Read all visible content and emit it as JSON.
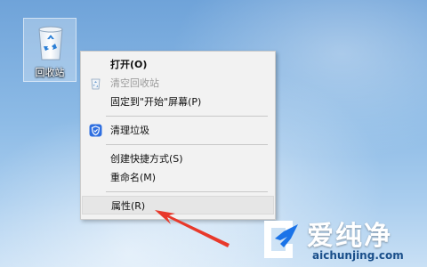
{
  "desktop": {
    "recycle_bin": {
      "label": "回收站",
      "icon": "recycle-bin-icon"
    }
  },
  "context_menu": {
    "items": [
      {
        "label": "打开(O)",
        "bold": true
      },
      {
        "label": "清空回收站",
        "disabled": true,
        "icon": "recycle-bin-empty-icon"
      },
      {
        "label": "固定到\"开始\"屏幕(P)"
      },
      {
        "label": "清理垃圾",
        "icon": "shield-clean-icon"
      },
      {
        "label": "创建快捷方式(S)"
      },
      {
        "label": "重命名(M)"
      },
      {
        "label": "属性(R)",
        "highlighted": true
      }
    ]
  },
  "annotation": {
    "arrow_color": "#e8392b"
  },
  "watermark": {
    "name": "爱纯净",
    "url": "aichunjing.com",
    "icon": "aichunjing-logo-icon"
  },
  "colors": {
    "menu_background": "#f2f2f2",
    "shield_blue": "#2f6fe0",
    "watermark_url": "#1a4f8a"
  }
}
